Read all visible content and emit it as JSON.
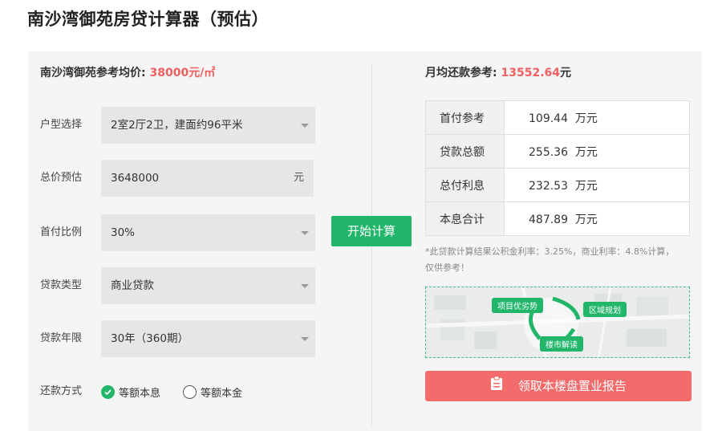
{
  "page": {
    "title": "南沙湾御苑房贷计算器（预估）"
  },
  "left": {
    "avg_price_label": "南沙湾御苑参考均价:",
    "avg_price_value": "38000元/㎡",
    "layout": {
      "label": "户型选择",
      "value": "2室2厅2卫，建面约96平米"
    },
    "total": {
      "label": "总价预估",
      "value": "3648000",
      "unit": "元"
    },
    "down": {
      "label": "首付比例",
      "value": "30%"
    },
    "loan_type": {
      "label": "贷款类型",
      "value": "商业贷款"
    },
    "years": {
      "label": "贷款年限",
      "value": "30年（360期）"
    },
    "repay": {
      "label": "还款方式",
      "option1": "等额本息",
      "option2": "等额本金",
      "selected": "等额本息"
    }
  },
  "calc_button": "开始计算",
  "right": {
    "monthly_label": "月均还款参考:",
    "monthly_value": "13552.64",
    "monthly_unit": "元",
    "rows": [
      {
        "label": "首付参考",
        "value": "109.44",
        "unit": "万元"
      },
      {
        "label": "贷款总额",
        "value": "255.36",
        "unit": "万元"
      },
      {
        "label": "总付利息",
        "value": "232.53",
        "unit": "万元"
      },
      {
        "label": "本息合计",
        "value": "487.89",
        "unit": "万元"
      }
    ],
    "note": "*此贷款计算结果公积金利率：3.25%，商业利率：4.8%计算，仅供参考！",
    "map_tags": {
      "t1": "项目优劣势",
      "t2": "区域规划",
      "t3": "楼市解读"
    },
    "report_button": "领取本楼盘置业报告"
  },
  "colors": {
    "accent_green": "#22b66b",
    "accent_red": "#f36b6b",
    "highlight": "#ef5f5f"
  },
  "icons": [
    "caret-down-icon",
    "check-circle-icon",
    "radio-empty-icon",
    "clipboard-icon"
  ]
}
